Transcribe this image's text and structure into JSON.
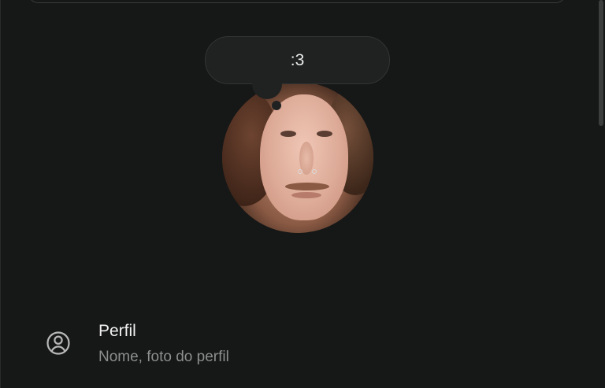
{
  "profile": {
    "status_text": ":3"
  },
  "settings": {
    "profile_row": {
      "title": "Perfil",
      "subtitle": "Nome, foto do perfil",
      "icon": "user-circle-icon"
    }
  },
  "colors": {
    "background": "#161717",
    "bubble": "#202222",
    "primary_text": "#f1f1f1",
    "secondary_text": "#8d8f8f",
    "icon": "#b8b8b8"
  }
}
